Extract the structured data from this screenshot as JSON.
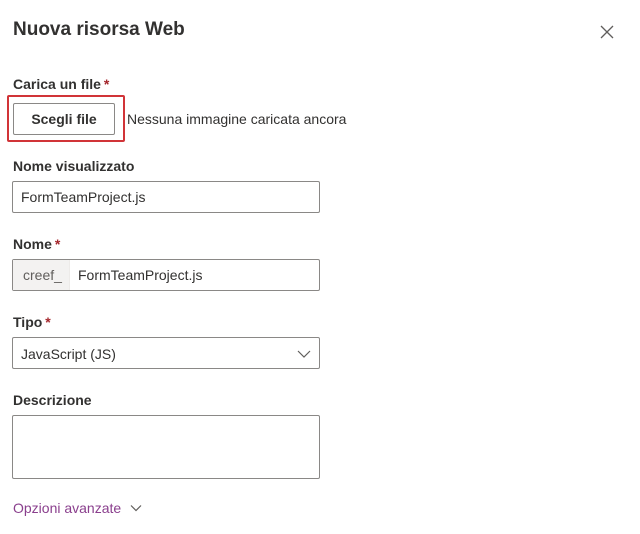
{
  "panel": {
    "title": "Nuova risorsa Web"
  },
  "upload": {
    "label": "Carica un file",
    "required_mark": "*",
    "button_label": "Scegli file",
    "status": "Nessuna immagine caricata ancora"
  },
  "display_name": {
    "label": "Nome visualizzato",
    "value": "FormTeamProject.js"
  },
  "name": {
    "label": "Nome",
    "required_mark": "*",
    "prefix": "creef_",
    "value": "FormTeamProject.js"
  },
  "type": {
    "label": "Tipo",
    "required_mark": "*",
    "selected": "JavaScript (JS)"
  },
  "description": {
    "label": "Descrizione",
    "value": ""
  },
  "advanced": {
    "label": "Opzioni avanzate"
  },
  "colors": {
    "highlight": "#d13438",
    "required": "#a4262c",
    "link": "#8a3f8d",
    "border": "#8a8886"
  },
  "icons": {
    "close": "close-icon",
    "dropdown": "chevron-down-icon",
    "expand": "chevron-down-icon"
  }
}
